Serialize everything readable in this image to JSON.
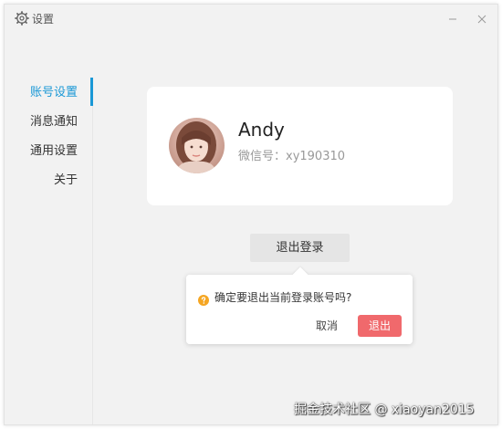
{
  "window": {
    "title": "设置",
    "icons": {
      "settings": "gear-icon",
      "minimize": "minimize-icon",
      "close": "close-icon"
    }
  },
  "sidebar": {
    "items": [
      {
        "label": "账号设置",
        "active": true
      },
      {
        "label": "消息通知",
        "active": false
      },
      {
        "label": "通用设置",
        "active": false
      },
      {
        "label": "关于",
        "active": false
      }
    ],
    "accent_color": "#1a98d6"
  },
  "profile": {
    "name": "Andy",
    "wechat_id": "微信号：xy190310"
  },
  "logout": {
    "button_label": "退出登录"
  },
  "confirm_popover": {
    "message": "确定要退出当前登录账号吗?",
    "cancel_label": "取消",
    "confirm_label": "退出",
    "icon": "warning-icon",
    "confirm_color": "#f0696c"
  },
  "watermark": {
    "text": "掘金技术社区 @ xiaoyan2015"
  }
}
